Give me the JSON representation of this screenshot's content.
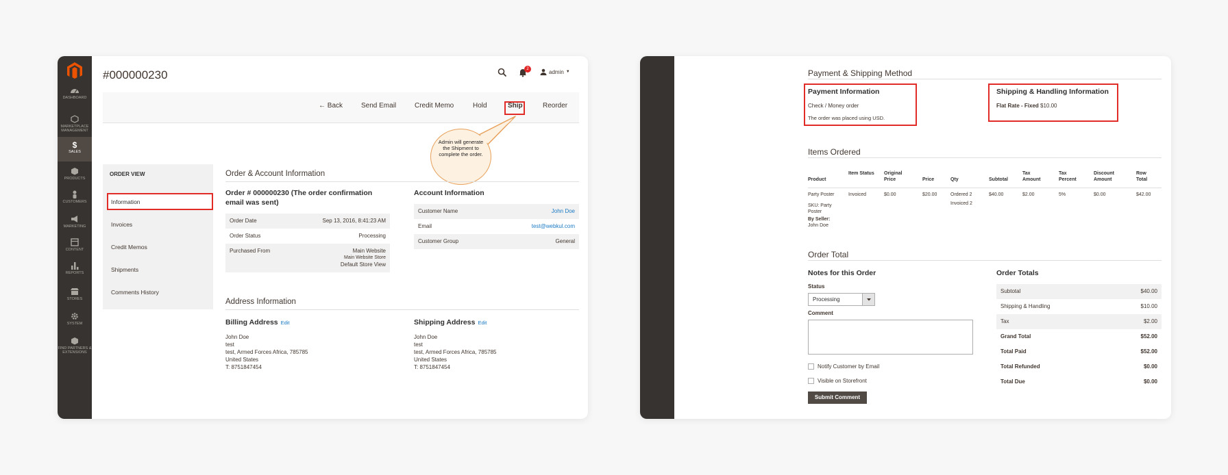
{
  "order_page": {
    "title": "#000000230",
    "badge_count": "2",
    "user": "admin",
    "nav": [
      {
        "label": "DASHBOARD"
      },
      {
        "label": "MARKETPLACE MANAGEMENT"
      },
      {
        "label": "SALES"
      },
      {
        "label": "PRODUCTS"
      },
      {
        "label": "CUSTOMERS"
      },
      {
        "label": "MARKETING"
      },
      {
        "label": "CONTENT"
      },
      {
        "label": "REPORTS"
      },
      {
        "label": "STORES"
      },
      {
        "label": "SYSTEM"
      },
      {
        "label": "FIND PARTNERS & EXTENSIONS"
      }
    ],
    "actions": {
      "back": "Back",
      "send_email": "Send Email",
      "credit_memo": "Credit Memo",
      "hold": "Hold",
      "ship": "Ship",
      "reorder": "Reorder"
    },
    "callout": "Admin will generate the Shipment to complete the order.",
    "order_view": {
      "heading": "ORDER VIEW",
      "tabs": [
        "Information",
        "Invoices",
        "Credit Memos",
        "Shipments",
        "Comments History"
      ]
    },
    "order_account_section": "Order & Account Information",
    "order_block": {
      "title": "Order # 000000230 (The order confirmation email was sent)",
      "rows": [
        {
          "label": "Order Date",
          "value": "Sep 13, 2016, 8:41:23 AM"
        },
        {
          "label": "Order Status",
          "value": "Processing"
        },
        {
          "label": "Purchased From",
          "value_lines": [
            "Main Website",
            "Main Website Store",
            "Default Store View"
          ]
        }
      ]
    },
    "account_block": {
      "title": "Account Information",
      "rows": [
        {
          "label": "Customer Name",
          "value": "John Doe"
        },
        {
          "label": "Email",
          "value": "test@webkul.com"
        },
        {
          "label": "Customer Group",
          "value": "General"
        }
      ]
    },
    "address_section": "Address Information",
    "billing": {
      "title": "Billing Address",
      "edit": "Edit",
      "lines": [
        "John Doe",
        "test",
        "test, Armed Forces Africa, 785785",
        "United States",
        "T: 8751847454"
      ]
    },
    "shipping": {
      "title": "Shipping Address",
      "edit": "Edit",
      "lines": [
        "John Doe",
        "test",
        "test, Armed Forces Africa, 785785",
        "United States",
        "T: 8751847454"
      ]
    }
  },
  "details_page": {
    "payment_shipping_section": "Payment & Shipping Method",
    "payment": {
      "title": "Payment Information",
      "method": "Check / Money order",
      "note": "The order was placed using USD."
    },
    "shipping_handling": {
      "title": "Shipping & Handling Information",
      "rate_label": "Flat Rate - Fixed",
      "rate_value": "$10.00"
    },
    "items_section": "Items Ordered",
    "items_headers": [
      "Product",
      "Item Status",
      "Original Price",
      "Price",
      "Qty",
      "Subtotal",
      "Tax Amount",
      "Tax Percent",
      "Discount Amount",
      "Row Total"
    ],
    "item": {
      "product": "Party Poster",
      "sku": "SKU: Party Poster",
      "by_seller": "By Seller:",
      "seller": "John Doe",
      "status": "Invoiced",
      "original_price": "$0.00",
      "price": "$20.00",
      "qty_ordered": "Ordered 2",
      "qty_invoiced": "Invoiced 2",
      "subtotal": "$40.00",
      "tax_amount": "$2.00",
      "tax_percent": "5%",
      "discount": "$0.00",
      "row_total": "$42.00"
    },
    "order_total_section": "Order Total",
    "notes": {
      "title": "Notes for this Order",
      "status_label": "Status",
      "status_value": "Processing",
      "comment_label": "Comment",
      "notify_label": "Notify Customer by Email",
      "visible_label": "Visible on Storefront",
      "submit": "Submit Comment"
    },
    "totals": {
      "title": "Order Totals",
      "rows": [
        {
          "label": "Subtotal",
          "value": "$40.00"
        },
        {
          "label": "Shipping & Handling",
          "value": "$10.00"
        },
        {
          "label": "Tax",
          "value": "$2.00"
        },
        {
          "label": "Grand Total",
          "value": "$52.00"
        },
        {
          "label": "Total Paid",
          "value": "$52.00"
        },
        {
          "label": "Total Refunded",
          "value": "$0.00"
        },
        {
          "label": "Total Due",
          "value": "$0.00"
        }
      ]
    }
  },
  "colors": {
    "highlight": "#e02b27",
    "sidebar": "#373330",
    "link": "#1979c3",
    "magento_orange": "#eb5202"
  }
}
